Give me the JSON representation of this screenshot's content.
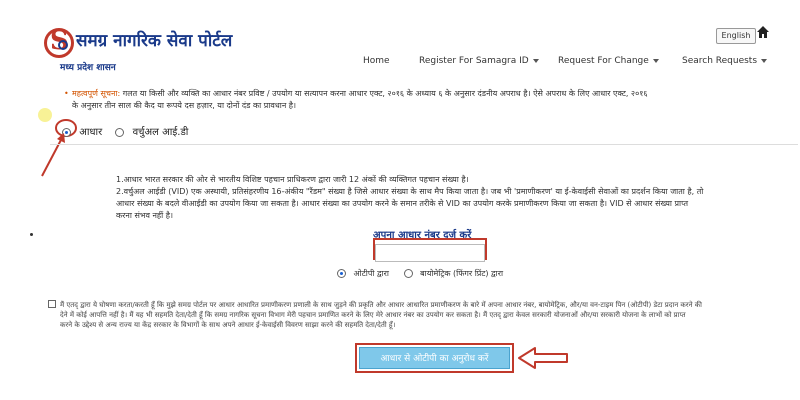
{
  "header": {
    "portal_title": "समग्र नागरिक सेवा पोर्टल",
    "portal_subtitle": "मध्य प्रदेश शासन",
    "lang_button": "English",
    "nav": [
      {
        "label": "Home"
      },
      {
        "label": "Register For Samagra ID"
      },
      {
        "label": "Request For Change"
      },
      {
        "label": "Search Requests"
      }
    ]
  },
  "notice": {
    "label": "महत्वपूर्ण सूचना:",
    "text_line1": "गलत या किसी और व्यक्ति का आधार नंबर प्रविष्ट / उपयोग या सत्यापन करना आधार एक्ट, २०१६ के अध्याय ६ के अनुसार दंडनीय अपराध है। ऐसे अपराध के लिए आधार एक्ट, २०१६",
    "text_line2": "के अनुसार तीन साल की कैद या रूपये दस हज़ार, या दोनों दंड का प्रावधान है।"
  },
  "id_type": {
    "options": [
      {
        "label": "आधार",
        "selected": true
      },
      {
        "label": "वर्चुअल आई.डी",
        "selected": false
      }
    ]
  },
  "info": {
    "line1": "1.आधार भारत सरकार की ओर से भारतीय विशिष्ट पहचान प्राधिकरण द्वारा जारी 12 अंकों की व्यक्तिगत पहचान संख्या है।",
    "line2": "2.वर्चुअल आईडी (VID) एक अस्थायी, प्रतिसंहरणीय 16-अंकीय \"रैंडम\" संख्या है जिसे आधार संख्या के साथ मैप किया जाता है। जब भी 'प्रमाणीकरण' या ई-केवाईसी सेवाओं का प्रदर्शन किया जाता है, तो",
    "line3": "आधार संख्या के बदले वीआईडी का उपयोग किया जा सकता है। आधार संख्या का उपयोग करने के समान तरीके से VID का उपयोग करके प्रमाणीकरण किया जा सकता है। VID से आधार संख्या प्राप्त",
    "line4": "करना संभव नहीं है।"
  },
  "aadhaar_input": {
    "label": "अपना आधार नंबर दर्ज करें",
    "value": "",
    "placeholder": ""
  },
  "auth_method": {
    "options": [
      {
        "label": "ओटीपी द्वारा",
        "selected": true
      },
      {
        "label": "बायोमेट्रिक (फिंगर प्रिंट) द्वारा",
        "selected": false
      }
    ]
  },
  "consent": {
    "line1": "मैं एतद् द्वारा ये घोषणा करता/करती हूँ कि मुझे समग्र पोर्टल पर आधार आधारित प्रमाणीकरण प्रणाली के साथ जुड़ने की प्रकृति और आधार आधारित प्रमाणीकरण के बारे में अपना आधार नंबर, बायोमेट्रिक, और/या वन-टाइम पिन (ओटीपी) डेटा प्रदान करने की",
    "line2": "देने में कोई आपत्ति नहीं है। मैं यह भी सहमति देता/देती हूँ कि समग्र नागरिक सूचना विभाग मेरी पहचान प्रमाणित करने के लिए मेरे आधार नंबर का उपयोग कर सकता है। मैं एतद् द्वारा केवल सरकारी योजनाओं और/या सरकारी योजना के लाभों को प्राप्त",
    "line3": "करने के उद्देश्य से अन्य राज्य या केंद्र सरकार के विभागों के साथ अपने आधार ई-केवाईसी विवरण साझा करने की सहमति देता/देती हूँ।"
  },
  "otp_button": {
    "label": "आधार से ओटीपी का अनुरोध करें"
  },
  "colors": {
    "brand_blue": "#1a3a8a",
    "annotation_red": "#c0392b",
    "button_blue": "#7fc8ea"
  }
}
